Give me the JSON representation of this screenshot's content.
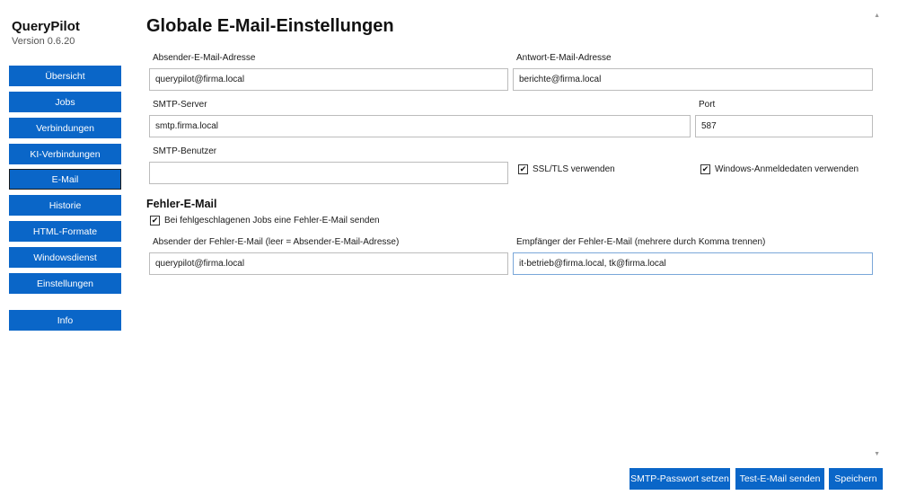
{
  "app": {
    "name": "QueryPilot",
    "version": "Version 0.6.20"
  },
  "sidebar": {
    "items": [
      {
        "label": "Übersicht"
      },
      {
        "label": "Jobs"
      },
      {
        "label": "Verbindungen"
      },
      {
        "label": "KI-Verbindungen"
      },
      {
        "label": "E-Mail",
        "active": true
      },
      {
        "label": "Historie"
      },
      {
        "label": "HTML-Formate"
      },
      {
        "label": "Windowsdienst"
      },
      {
        "label": "Einstellungen"
      }
    ],
    "info_label": "Info"
  },
  "page": {
    "title": "Globale E-Mail-Einstellungen"
  },
  "form": {
    "sender": {
      "label": "Absender-E-Mail-Adresse",
      "value": "querypilot@firma.local"
    },
    "reply": {
      "label": "Antwort-E-Mail-Adresse",
      "value": "berichte@firma.local"
    },
    "smtp_server": {
      "label": "SMTP-Server",
      "value": "smtp.firma.local"
    },
    "port": {
      "label": "Port",
      "value": "587"
    },
    "smtp_user": {
      "label": "SMTP-Benutzer",
      "value": ""
    },
    "ssl_tls": {
      "label": "SSL/TLS verwenden",
      "checked": true
    },
    "windows_creds": {
      "label": "Windows-Anmeldedaten verwenden",
      "checked": true
    }
  },
  "error_mail": {
    "section_title": "Fehler-E-Mail",
    "send_on_fail": {
      "label": "Bei fehlgeschlagenen Jobs eine Fehler-E-Mail senden",
      "checked": true
    },
    "sender": {
      "label": "Absender der Fehler-E-Mail (leer = Absender-E-Mail-Adresse)",
      "value": "querypilot@firma.local"
    },
    "recipients": {
      "label": "Empfänger der Fehler-E-Mail (mehrere durch Komma trennen)",
      "value": "it-betrieb@firma.local, tk@firma.local"
    }
  },
  "actions": {
    "set_password": "SMTP-Passwort setzen",
    "test_mail": "Test-E-Mail senden",
    "save": "Speichern"
  },
  "icons": {
    "check": "✔",
    "scroll_up": "▲",
    "scroll_down": "▼"
  },
  "colors": {
    "accent": "#0a66c8"
  }
}
